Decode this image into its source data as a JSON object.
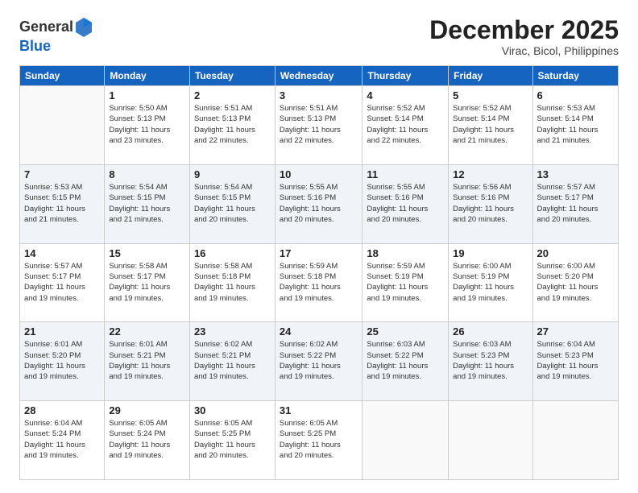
{
  "logo": {
    "general": "General",
    "blue": "Blue"
  },
  "header": {
    "month_year": "December 2025",
    "location": "Virac, Bicol, Philippines"
  },
  "days_of_week": [
    "Sunday",
    "Monday",
    "Tuesday",
    "Wednesday",
    "Thursday",
    "Friday",
    "Saturday"
  ],
  "weeks": [
    [
      {
        "num": "",
        "info": ""
      },
      {
        "num": "1",
        "info": "Sunrise: 5:50 AM\nSunset: 5:13 PM\nDaylight: 11 hours\nand 23 minutes."
      },
      {
        "num": "2",
        "info": "Sunrise: 5:51 AM\nSunset: 5:13 PM\nDaylight: 11 hours\nand 22 minutes."
      },
      {
        "num": "3",
        "info": "Sunrise: 5:51 AM\nSunset: 5:13 PM\nDaylight: 11 hours\nand 22 minutes."
      },
      {
        "num": "4",
        "info": "Sunrise: 5:52 AM\nSunset: 5:14 PM\nDaylight: 11 hours\nand 22 minutes."
      },
      {
        "num": "5",
        "info": "Sunrise: 5:52 AM\nSunset: 5:14 PM\nDaylight: 11 hours\nand 21 minutes."
      },
      {
        "num": "6",
        "info": "Sunrise: 5:53 AM\nSunset: 5:14 PM\nDaylight: 11 hours\nand 21 minutes."
      }
    ],
    [
      {
        "num": "7",
        "info": "Sunrise: 5:53 AM\nSunset: 5:15 PM\nDaylight: 11 hours\nand 21 minutes."
      },
      {
        "num": "8",
        "info": "Sunrise: 5:54 AM\nSunset: 5:15 PM\nDaylight: 11 hours\nand 21 minutes."
      },
      {
        "num": "9",
        "info": "Sunrise: 5:54 AM\nSunset: 5:15 PM\nDaylight: 11 hours\nand 20 minutes."
      },
      {
        "num": "10",
        "info": "Sunrise: 5:55 AM\nSunset: 5:16 PM\nDaylight: 11 hours\nand 20 minutes."
      },
      {
        "num": "11",
        "info": "Sunrise: 5:55 AM\nSunset: 5:16 PM\nDaylight: 11 hours\nand 20 minutes."
      },
      {
        "num": "12",
        "info": "Sunrise: 5:56 AM\nSunset: 5:16 PM\nDaylight: 11 hours\nand 20 minutes."
      },
      {
        "num": "13",
        "info": "Sunrise: 5:57 AM\nSunset: 5:17 PM\nDaylight: 11 hours\nand 20 minutes."
      }
    ],
    [
      {
        "num": "14",
        "info": "Sunrise: 5:57 AM\nSunset: 5:17 PM\nDaylight: 11 hours\nand 19 minutes."
      },
      {
        "num": "15",
        "info": "Sunrise: 5:58 AM\nSunset: 5:17 PM\nDaylight: 11 hours\nand 19 minutes."
      },
      {
        "num": "16",
        "info": "Sunrise: 5:58 AM\nSunset: 5:18 PM\nDaylight: 11 hours\nand 19 minutes."
      },
      {
        "num": "17",
        "info": "Sunrise: 5:59 AM\nSunset: 5:18 PM\nDaylight: 11 hours\nand 19 minutes."
      },
      {
        "num": "18",
        "info": "Sunrise: 5:59 AM\nSunset: 5:19 PM\nDaylight: 11 hours\nand 19 minutes."
      },
      {
        "num": "19",
        "info": "Sunrise: 6:00 AM\nSunset: 5:19 PM\nDaylight: 11 hours\nand 19 minutes."
      },
      {
        "num": "20",
        "info": "Sunrise: 6:00 AM\nSunset: 5:20 PM\nDaylight: 11 hours\nand 19 minutes."
      }
    ],
    [
      {
        "num": "21",
        "info": "Sunrise: 6:01 AM\nSunset: 5:20 PM\nDaylight: 11 hours\nand 19 minutes."
      },
      {
        "num": "22",
        "info": "Sunrise: 6:01 AM\nSunset: 5:21 PM\nDaylight: 11 hours\nand 19 minutes."
      },
      {
        "num": "23",
        "info": "Sunrise: 6:02 AM\nSunset: 5:21 PM\nDaylight: 11 hours\nand 19 minutes."
      },
      {
        "num": "24",
        "info": "Sunrise: 6:02 AM\nSunset: 5:22 PM\nDaylight: 11 hours\nand 19 minutes."
      },
      {
        "num": "25",
        "info": "Sunrise: 6:03 AM\nSunset: 5:22 PM\nDaylight: 11 hours\nand 19 minutes."
      },
      {
        "num": "26",
        "info": "Sunrise: 6:03 AM\nSunset: 5:23 PM\nDaylight: 11 hours\nand 19 minutes."
      },
      {
        "num": "27",
        "info": "Sunrise: 6:04 AM\nSunset: 5:23 PM\nDaylight: 11 hours\nand 19 minutes."
      }
    ],
    [
      {
        "num": "28",
        "info": "Sunrise: 6:04 AM\nSunset: 5:24 PM\nDaylight: 11 hours\nand 19 minutes."
      },
      {
        "num": "29",
        "info": "Sunrise: 6:05 AM\nSunset: 5:24 PM\nDaylight: 11 hours\nand 19 minutes."
      },
      {
        "num": "30",
        "info": "Sunrise: 6:05 AM\nSunset: 5:25 PM\nDaylight: 11 hours\nand 20 minutes."
      },
      {
        "num": "31",
        "info": "Sunrise: 6:05 AM\nSunset: 5:25 PM\nDaylight: 11 hours\nand 20 minutes."
      },
      {
        "num": "",
        "info": ""
      },
      {
        "num": "",
        "info": ""
      },
      {
        "num": "",
        "info": ""
      }
    ]
  ]
}
